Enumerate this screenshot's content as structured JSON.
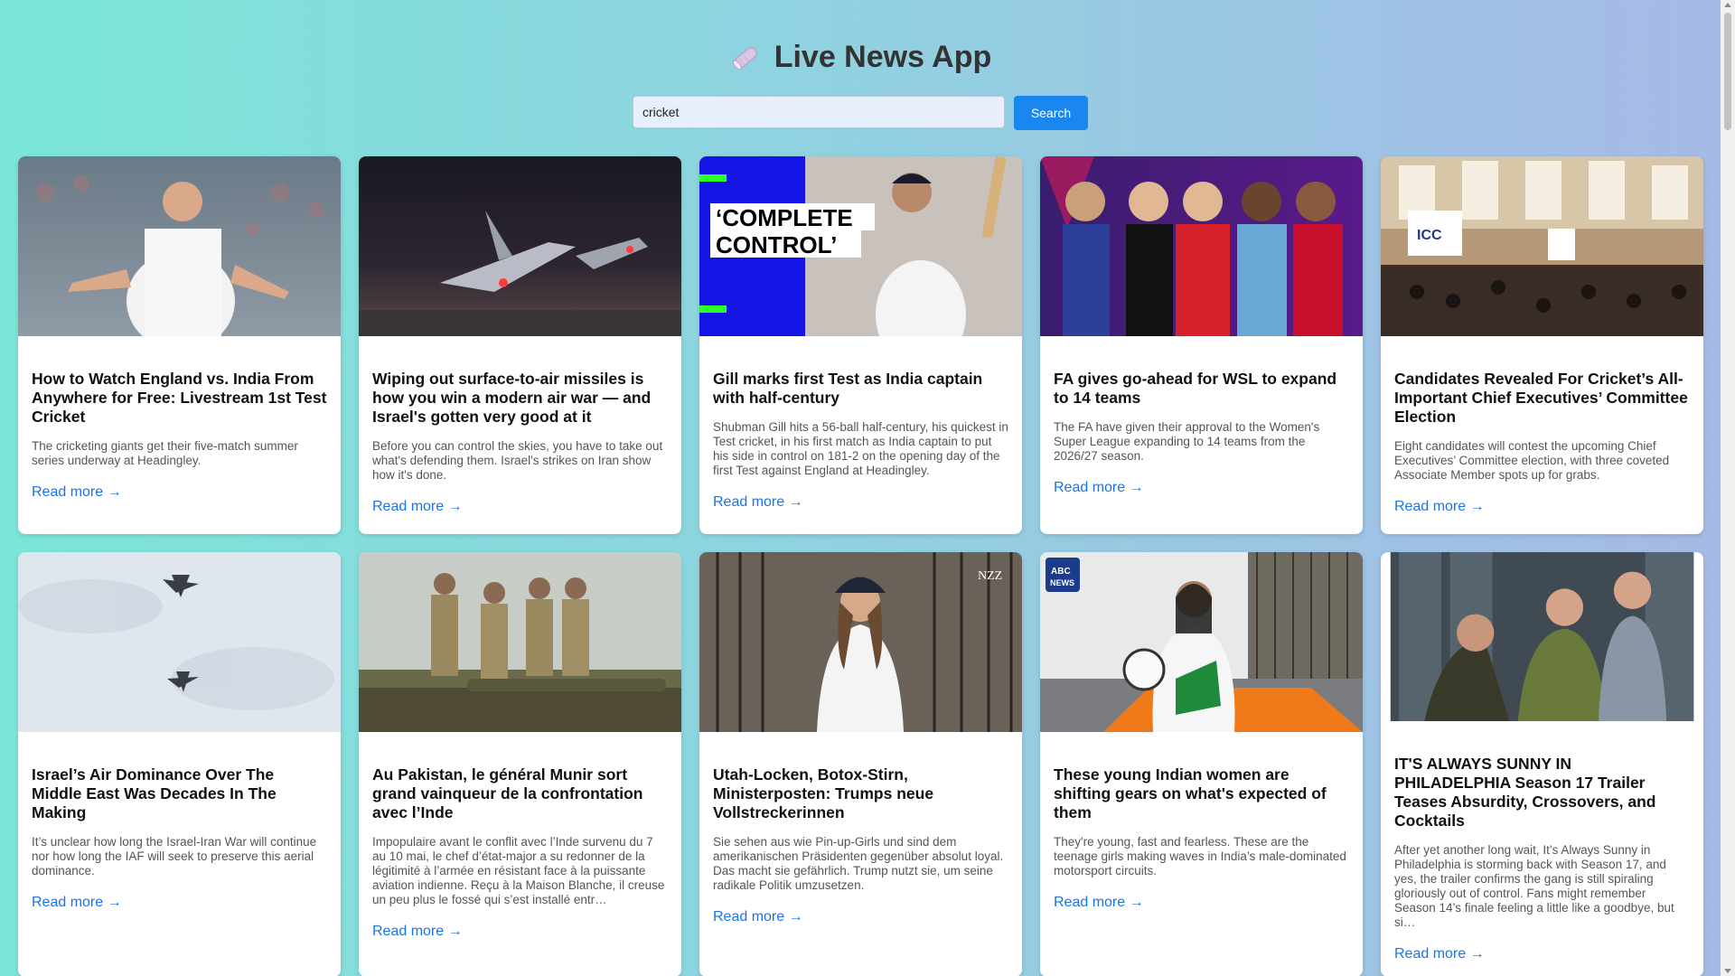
{
  "app": {
    "title": "Live News App",
    "icon": "newspaper-roll-icon"
  },
  "search": {
    "value": "cricket",
    "placeholder": "",
    "button_label": "Search"
  },
  "articles": [
    {
      "title": "How to Watch England vs. India From Anywhere for Free: Livestream 1st Test Cricket",
      "description": "The cricketing giants get their five-match summer series underway at Headingley.",
      "read_more": "Read more →",
      "image": "england-cricketer-celebrating"
    },
    {
      "title": "Wiping out surface-to-air missiles is how you win a modern air war — and Israel's gotten very good at it",
      "description": "Before you can control the skies, you have to take out what's defending them. Israel's strikes on Iran show how it's done.",
      "read_more": "Read more →",
      "image": "fighter-jets-night"
    },
    {
      "title": "Gill marks first Test as India captain with half-century",
      "description": "Shubman Gill hits a 56-ball half-century, his quickest in Test cricket, in his first match as India captain to put his side in control on 181-2 on the opening day of the first Test against England at Headingley.",
      "read_more": "Read more →",
      "image": "complete-control-graphic",
      "image_text": [
        "‘COMPLETE",
        "CONTROL’"
      ]
    },
    {
      "title": "FA gives go-ahead for WSL to expand to 14 teams",
      "description": "The FA have given their approval to the Women's Super League expanding to 14 teams from the 2026/27 season.",
      "read_more": "Read more →",
      "image": "wsl-players"
    },
    {
      "title": "Candidates Revealed For Cricket’s All-Important Chief Executives’ Committee Election",
      "description": "Eight candidates will contest the upcoming Chief Executives’ Committee election, with three coveted Associate Member spots up for grabs.",
      "read_more": "Read more →",
      "image": "icc-conference-hall",
      "image_text": [
        "ICC"
      ]
    },
    {
      "title": "Israel’s Air Dominance Over The Middle East Was Decades In The Making",
      "description": "It’s unclear how long the Israel-Iran War will continue nor how long the IAF will seek to preserve this aerial dominance.",
      "read_more": "Read more →",
      "image": "jets-in-sky"
    },
    {
      "title": "Au Pakistan, le général Munir sort grand vainqueur de la confrontation avec l’Inde",
      "description": "Impopulaire avant le conflit avec l’Inde survenu du 7 au 10 mai, le chef d’état-major a su redonner de la légitimité à l’armée en résistant face à la puissante aviation indienne. Reçu à la Maison Blanche, il creuse un peu plus le fossé qui s’est installé entr…",
      "read_more": "Read more →",
      "image": "military-officers"
    },
    {
      "title": "Utah-Locken, Botox-Stirn, Ministerposten: Trumps neue Vollstreckerinnen",
      "description": "Sie sehen aus wie Pin-up-Girls und sind dem amerikanischen Präsidenten gegenüber absolut loyal. Das macht sie gefährlich. Trump nutzt sie, um seine radikale Politik umzusetzen.",
      "read_more": "Read more →",
      "image": "woman-in-cap",
      "image_text": [
        "NZZ"
      ]
    },
    {
      "title": "These young Indian women are shifting gears on what's expected of them",
      "description": "They're young, fast and fearless. These are the teenage girls making waves in India’s male-dominated motorsport circuits.",
      "read_more": "Read more →",
      "image": "racing-driver",
      "image_text": [
        "ABC",
        "NEWS"
      ]
    },
    {
      "title": "IT'S ALWAYS SUNNY IN PHILADELPHIA Season 17 Trailer Teases Absurdity, Crossovers, and Cocktails",
      "description": "After yet another long wait, It’s Always Sunny in Philadelphia is storming back with Season 17, and yes, the trailer confirms the gang is still spiraling gloriously out of control. Fans might remember Season 14’s finale feeling a little like a goodbye, but si…",
      "read_more": "Read more →",
      "image": "sunny-cast"
    }
  ]
}
